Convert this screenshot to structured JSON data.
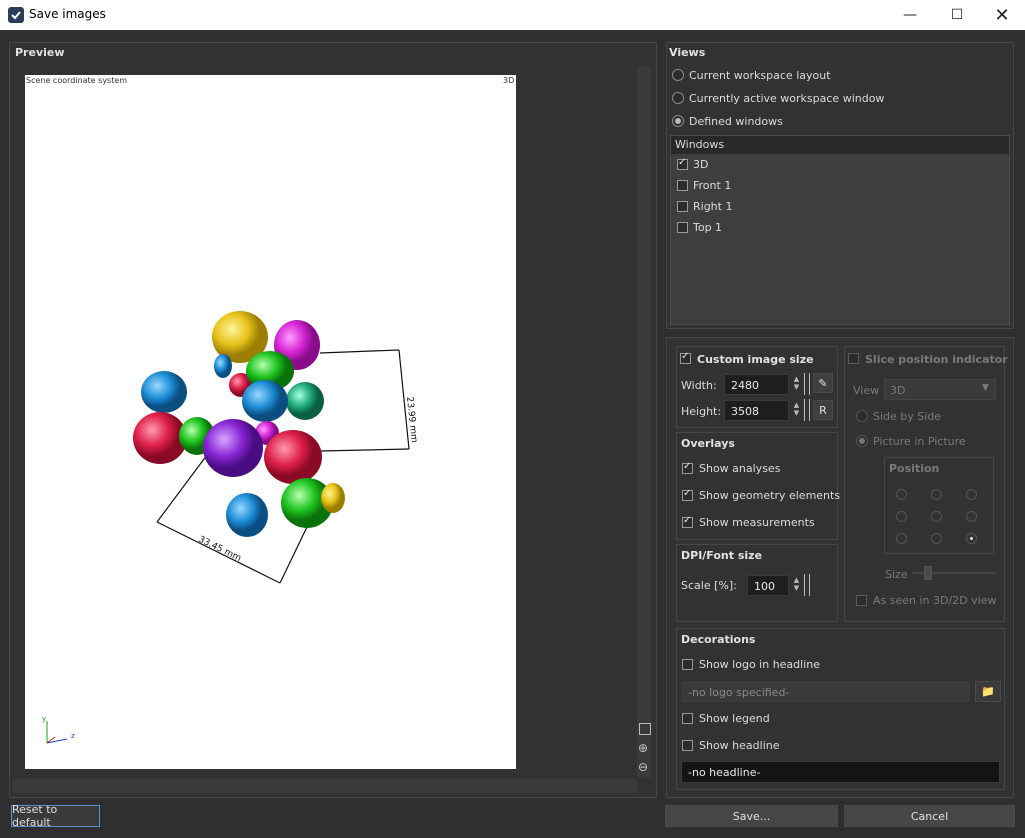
{
  "window": {
    "title": "Save images"
  },
  "preview": {
    "title": "Preview",
    "coord_label": "Scene coordinate system",
    "view_label": "3D",
    "measure_vertical": "23.99 mm",
    "measure_horizontal": "33.45 mm",
    "axis_y": "y",
    "axis_z": "z"
  },
  "views": {
    "title": "Views",
    "options": [
      "Current workspace layout",
      "Currently active workspace window",
      "Defined windows"
    ],
    "windows_header": "Windows",
    "windows": [
      {
        "label": "3D",
        "checked": true
      },
      {
        "label": "Front 1",
        "checked": false
      },
      {
        "label": "Right 1",
        "checked": false
      },
      {
        "label": "Top 1",
        "checked": false
      }
    ]
  },
  "image_size": {
    "title": "Custom image size",
    "width_label": "Width:",
    "width_value": "2480",
    "height_label": "Height:",
    "height_value": "3508",
    "r_label": "R"
  },
  "slice": {
    "title": "Slice position indicator",
    "view_label": "View",
    "view_value": "3D",
    "side_by_side": "Side by Side",
    "pip": "Picture in Picture",
    "position_title": "Position",
    "size_label": "Size",
    "as_seen": "As seen in 3D/2D view"
  },
  "overlays": {
    "title": "Overlays",
    "items": [
      "Show analyses",
      "Show geometry elements",
      "Show measurements"
    ]
  },
  "dpi": {
    "title": "DPI/Font size",
    "scale_label": "Scale [%]:",
    "scale_value": "100"
  },
  "decorations": {
    "title": "Decorations",
    "show_logo": "Show logo in headline",
    "logo_placeholder": "-no logo specified-",
    "show_legend": "Show legend",
    "show_headline": "Show headline",
    "headline_value": "-no headline-"
  },
  "buttons": {
    "reset": "Reset to default",
    "save": "Save...",
    "cancel": "Cancel"
  }
}
